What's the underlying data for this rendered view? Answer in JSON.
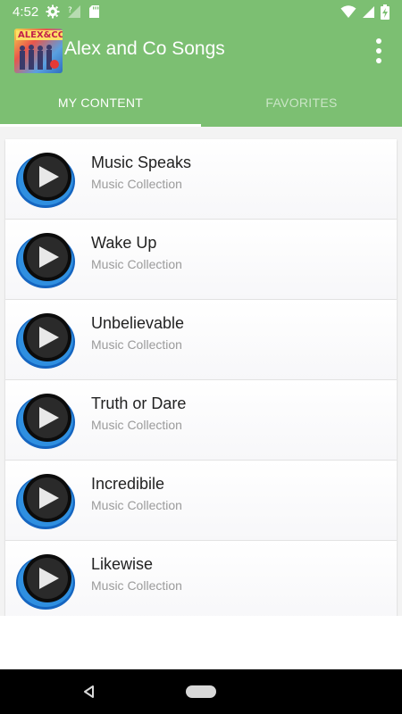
{
  "status_bar": {
    "time": "4:52",
    "icons": [
      "settings-icon",
      "no-sim-signal-icon",
      "sd-card-icon",
      "wifi-icon",
      "signal-icon",
      "battery-charging-icon"
    ]
  },
  "app_bar": {
    "logo_text": "ALEX&CO",
    "title": "Alex and Co Songs",
    "overflow_icon": "more-vert-icon"
  },
  "tabs": [
    {
      "label": "MY CONTENT",
      "active": true
    },
    {
      "label": "FAVORITES",
      "active": false
    }
  ],
  "songs": [
    {
      "title": "Music Speaks",
      "subtitle": "Music Collection"
    },
    {
      "title": "Wake Up",
      "subtitle": "Music Collection"
    },
    {
      "title": "Unbelievable",
      "subtitle": "Music Collection"
    },
    {
      "title": "Truth or Dare",
      "subtitle": "Music Collection"
    },
    {
      "title": "Incredibile",
      "subtitle": "Music Collection"
    },
    {
      "title": "Likewise",
      "subtitle": "Music Collection"
    }
  ],
  "colors": {
    "primary": "#7cbf72",
    "title_text": "#222222",
    "subtitle_text": "#9b9b9b",
    "play_ring_blue": "#2f8fe0"
  }
}
